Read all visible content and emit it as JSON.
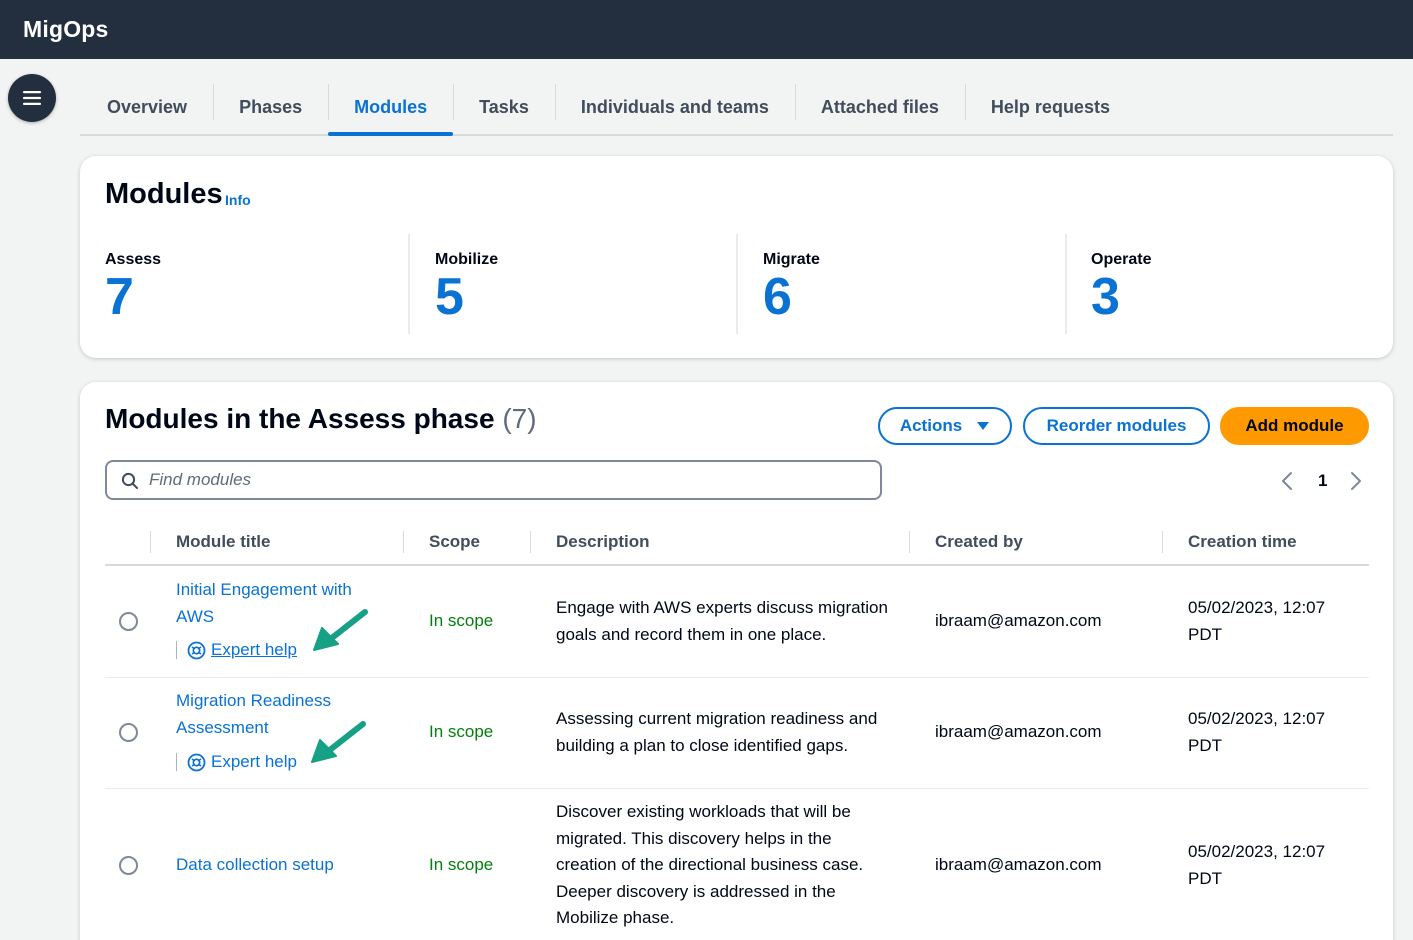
{
  "app": {
    "brand": "MigOps"
  },
  "tabs": [
    {
      "label": "Overview",
      "active": false
    },
    {
      "label": "Phases",
      "active": false
    },
    {
      "label": "Modules",
      "active": true
    },
    {
      "label": "Tasks",
      "active": false
    },
    {
      "label": "Individuals and teams",
      "active": false
    },
    {
      "label": "Attached files",
      "active": false
    },
    {
      "label": "Help requests",
      "active": false
    }
  ],
  "summary": {
    "title": "Modules",
    "info_label": "Info",
    "stats": [
      {
        "label": "Assess",
        "value": "7"
      },
      {
        "label": "Mobilize",
        "value": "5"
      },
      {
        "label": "Migrate",
        "value": "6"
      },
      {
        "label": "Operate",
        "value": "3"
      }
    ]
  },
  "phase_table": {
    "title": "Modules in the Assess phase",
    "count": "(7)",
    "actions_label": "Actions",
    "reorder_label": "Reorder modules",
    "add_label": "Add module",
    "search_placeholder": "Find modules",
    "page": "1",
    "columns": [
      "Module title",
      "Scope",
      "Description",
      "Created by",
      "Creation time"
    ],
    "rows": [
      {
        "title_line1": "Initial Engagement with",
        "title_line2": "AWS",
        "expert_help": "Expert help",
        "scope": "In scope",
        "desc_line1": "Engage with AWS experts discuss migration",
        "desc_line2": "goals and record them in one place.",
        "created_by": "ibraam@amazon.com",
        "time_line1": "05/02/2023, 12:07",
        "time_line2": "PDT"
      },
      {
        "title_line1": "Migration Readiness",
        "title_line2": "Assessment",
        "expert_help": "Expert help",
        "scope": "In scope",
        "desc_line1": "Assessing current migration readiness and",
        "desc_line2": "building a plan to close identified gaps.",
        "created_by": "ibraam@amazon.com",
        "time_line1": "05/02/2023, 12:07",
        "time_line2": "PDT"
      },
      {
        "title_line1": "Data collection setup",
        "scope": "In scope",
        "desc_line1": "Discover existing workloads that will be",
        "desc_line2": "migrated. This discovery helps in the",
        "desc_line3": "creation of the directional business case.",
        "desc_line4": "Deeper discovery is addressed in the",
        "desc_line5": "Mobilize phase.",
        "created_by": "ibraam@amazon.com",
        "time_line1": "05/02/2023, 12:07",
        "time_line2": "PDT"
      }
    ]
  },
  "colors": {
    "topbar": "#232f3e",
    "accent": "#0972d3",
    "primary_button": "#ff9900",
    "scope_green": "#037f0c",
    "annotation_arrow": "#16a085"
  },
  "icons": [
    "menu-icon",
    "search-icon",
    "chevron-left-icon",
    "chevron-right-icon",
    "caret-down-icon",
    "expert-help-icon",
    "annotation-arrow"
  ]
}
